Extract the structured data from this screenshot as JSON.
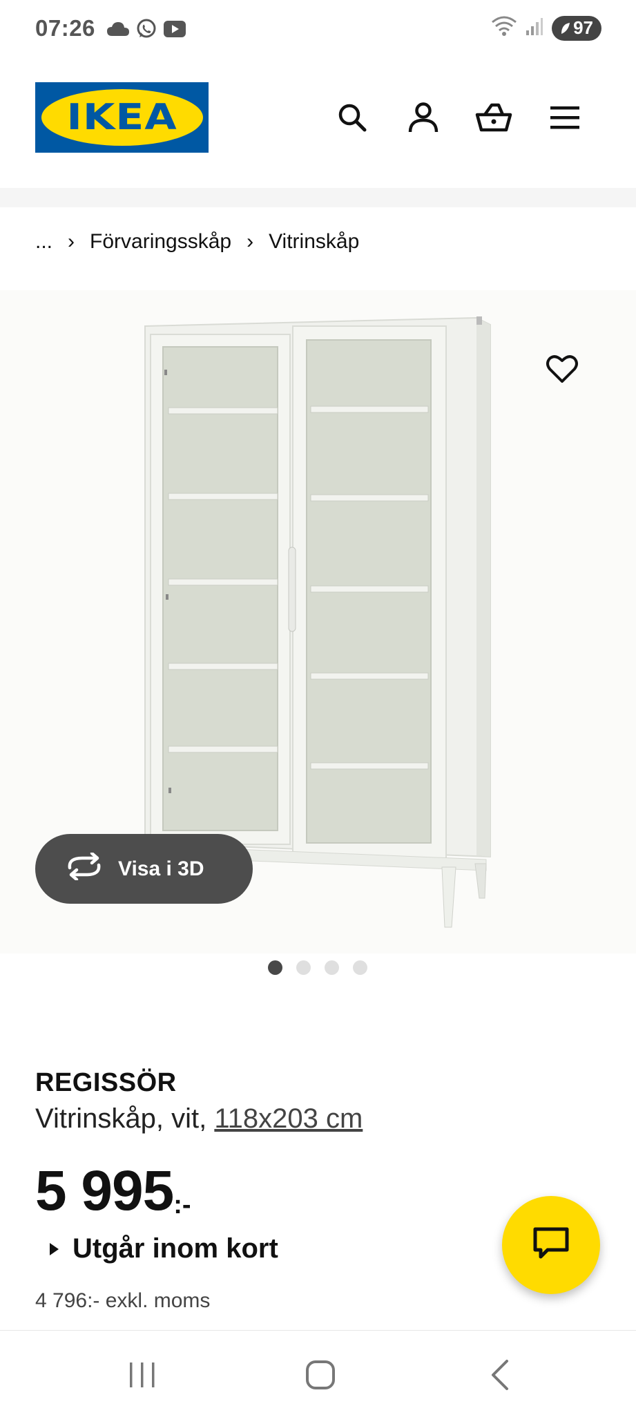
{
  "status_bar": {
    "time": "07:26",
    "left_icons": [
      "cloud-icon",
      "whatsapp-icon",
      "youtube-icon"
    ],
    "right_icons": [
      "wifi-icon",
      "signal-icon"
    ],
    "battery": "97"
  },
  "header": {
    "logo_text": "IKEA",
    "icons": [
      "search-icon",
      "user-icon",
      "basket-icon",
      "menu-icon"
    ]
  },
  "breadcrumb": {
    "ellipsis": "...",
    "separator": "›",
    "items": [
      "Förvaringsskåp",
      "Vitrinskåp"
    ]
  },
  "product_image": {
    "view3d_label": "Visa i 3D",
    "carousel_count": 4,
    "carousel_active": 1
  },
  "product": {
    "name": "REGISSÖR",
    "description": "Vitrinskåp, vit, ",
    "size_link": "118x203 cm",
    "price": "5 995",
    "price_suffix": ":-",
    "availability_notice": "Utgår inom kort",
    "price_excl_vat": "4 796:- exkl. moms"
  },
  "colors": {
    "ikea_blue": "#0058a3",
    "ikea_yellow": "#ffdb00",
    "dark_button": "#4d4d4d"
  }
}
